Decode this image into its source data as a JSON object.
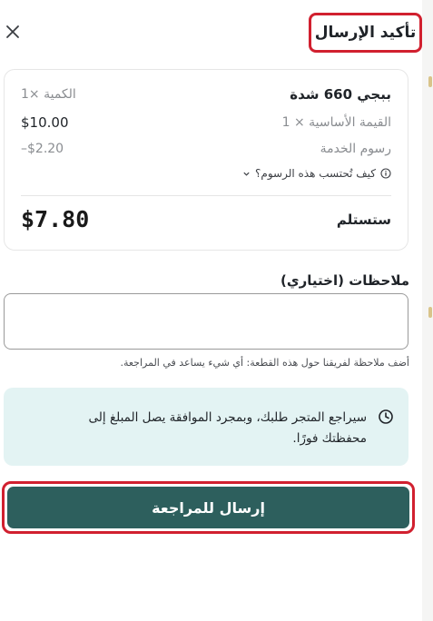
{
  "header": {
    "title": "تأكيد الإرسال"
  },
  "summary": {
    "product_name": "ببجي 660 شدة",
    "quantity": "الكمية ×1",
    "base_price_label": "القيمة الأساسية × 1",
    "base_price_value": "$10.00",
    "service_fee_label": "رسوم الخدمة",
    "service_fee_value": "–$2.20",
    "fee_info_link": "كيف تُحتسب هذه الرسوم؟",
    "total_label": "ستستلم",
    "total_value": "$7.80"
  },
  "notes": {
    "label": "ملاحظات (اختياري)",
    "value": "",
    "placeholder": "",
    "help_text": "أضف ملاحظة لفريقنا حول هذه القطعة: أي شيء يساعد في المراجعة."
  },
  "info": {
    "message": "سيراجع المتجر طلبك، وبمجرد الموافقة يصل المبلغ إلى محفظتك فورًا."
  },
  "actions": {
    "submit_label": "إرسال للمراجعة"
  },
  "icons": [
    "close-icon",
    "info-icon",
    "chevron-down-icon",
    "clock-icon"
  ],
  "colors": {
    "primary": "#2d5f5d",
    "info_bg": "#e3f3f3",
    "highlight": "#d1202f"
  }
}
